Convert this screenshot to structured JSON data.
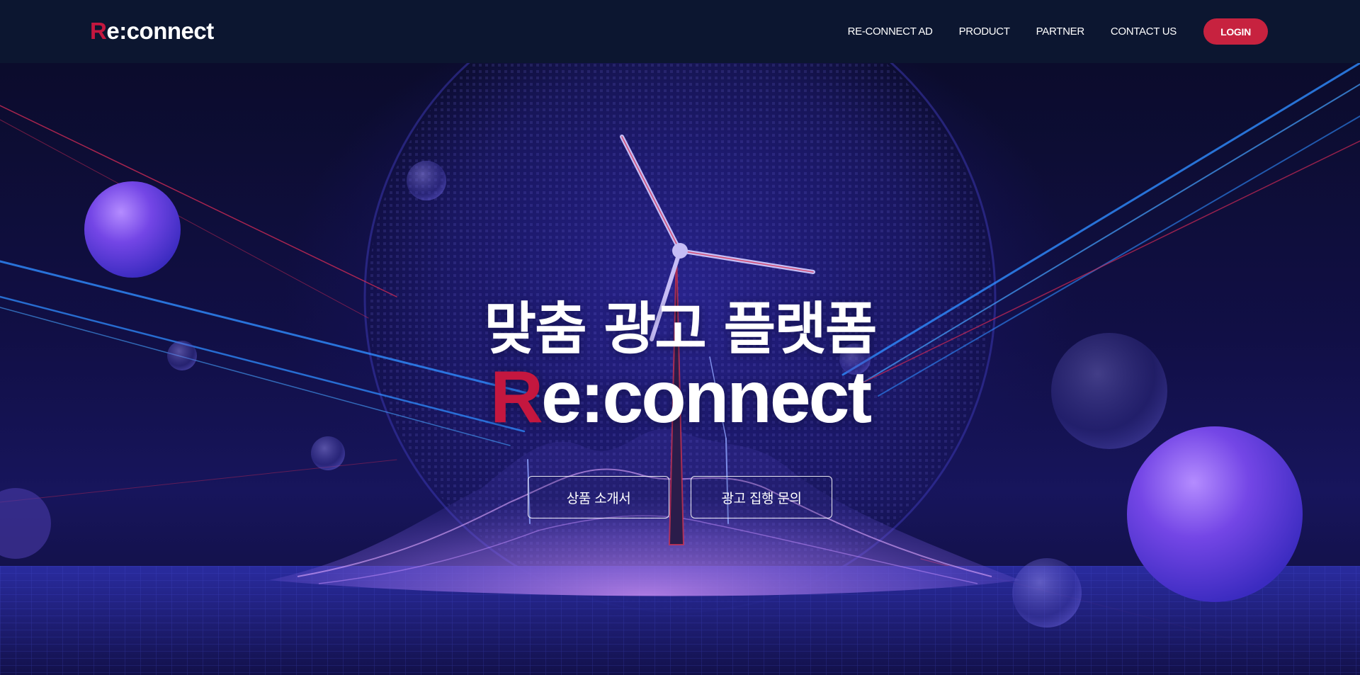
{
  "header": {
    "logo": {
      "first_letter": "R",
      "rest": "e:connect"
    },
    "nav": [
      {
        "label": "RE-CONNECT AD"
      },
      {
        "label": "PRODUCT"
      },
      {
        "label": "PARTNER"
      },
      {
        "label": "CONTACT US"
      }
    ],
    "login_label": "LOGIN"
  },
  "hero": {
    "title": "맞춤 광고 플랫폼",
    "brand": {
      "first_letter": "R",
      "rest": "e:connect"
    },
    "buttons": [
      {
        "label": "상품 소개서"
      },
      {
        "label": "광고 집행 문의"
      }
    ]
  },
  "colors": {
    "header_bg": "#0c1630",
    "accent": "#c4173f",
    "login_bg": "#c7223f",
    "hero_bg": "#110f46"
  }
}
